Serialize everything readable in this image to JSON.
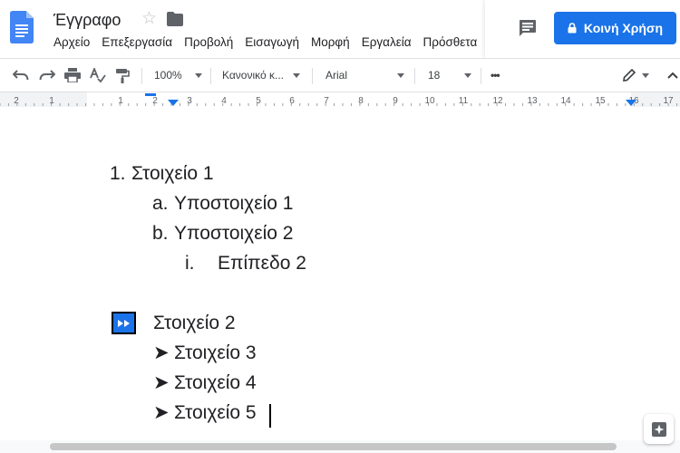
{
  "header": {
    "title": "Έγγραφο",
    "star_glyph": "☆",
    "menu": [
      "Αρχείο",
      "Επεξεργασία",
      "Προβολή",
      "Εισαγωγή",
      "Μορφή",
      "Εργαλεία",
      "Πρόσθετα"
    ],
    "share_label": "Κοινή Χρήση"
  },
  "toolbar": {
    "zoom": "100%",
    "style": "Κανονικό κ...",
    "font": "Arial",
    "font_size": "18",
    "more": "•••"
  },
  "ruler": {
    "labels": [
      "2",
      "1",
      "1",
      "2",
      "3",
      "4",
      "5",
      "6",
      "7",
      "8",
      "9",
      "10",
      "11",
      "12",
      "13",
      "14",
      "15",
      "16",
      "17"
    ]
  },
  "document": {
    "list_items": [
      {
        "marker": "1.",
        "text": "Στοιχείο 1"
      },
      {
        "marker": "a.",
        "text": "Υποστοιχείο 1"
      },
      {
        "marker": "b.",
        "text": "Υποστοιχείο 2"
      },
      {
        "marker": "i.",
        "text": "Επίπεδο 2"
      },
      {
        "marker": "",
        "text": "Στοιχείο 2"
      },
      {
        "marker": "➤",
        "text": "Στοιχείο 3"
      },
      {
        "marker": "➤",
        "text": "Στοιχείο 4"
      },
      {
        "marker": "➤",
        "text": "Στοιχείο 5"
      }
    ]
  },
  "colors": {
    "accent": "#1a73e8",
    "docs_blue": "#4285f4"
  }
}
